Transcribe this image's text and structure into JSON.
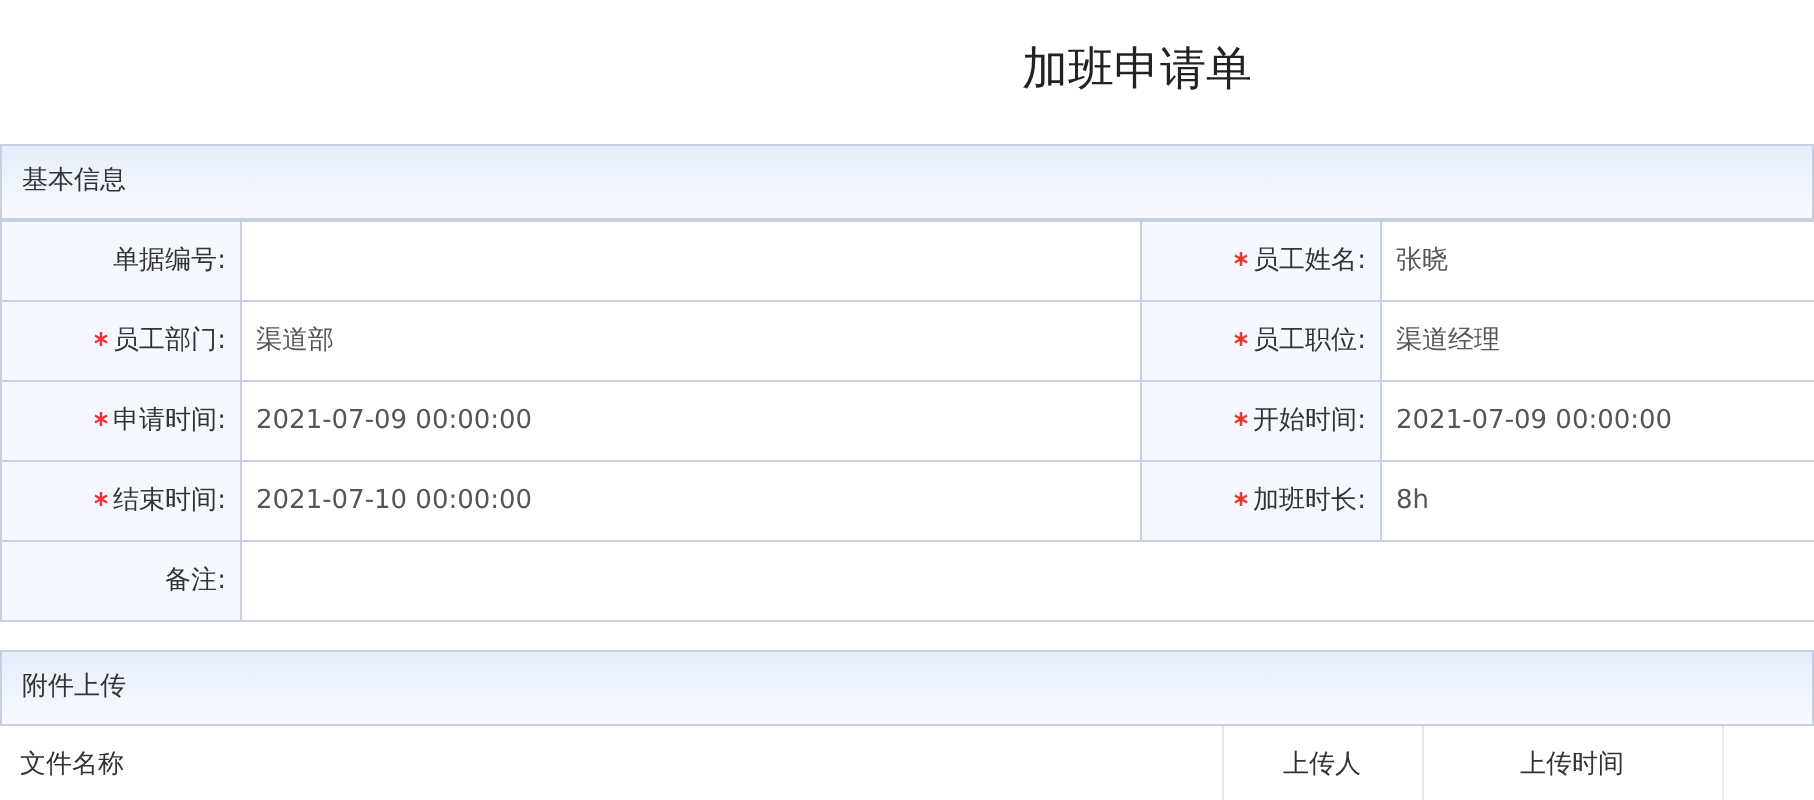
{
  "title": "加班申请单",
  "basic_info": {
    "heading": "基本信息",
    "rows": [
      [
        {
          "label": "单据编号:",
          "required": false
        },
        {
          "label": "员工姓名:",
          "required": true,
          "value": "张晓"
        }
      ],
      [
        {
          "label": "员工部门:",
          "required": true,
          "value": "渠道部"
        },
        {
          "label": "员工职位:",
          "required": true,
          "value": "渠道经理"
        }
      ],
      [
        {
          "label": "申请时间:",
          "required": true,
          "value": "2021-07-09 00:00:00"
        },
        {
          "label": "开始时间:",
          "required": true,
          "value": "2021-07-09 00:00:00"
        }
      ],
      [
        {
          "label": "结束时间:",
          "required": true,
          "value": "2021-07-10 00:00:00"
        },
        {
          "label": "加班时长:",
          "required": true,
          "value": "8h"
        }
      ],
      [
        {
          "label": "备注:",
          "required": false
        }
      ]
    ]
  },
  "attachments": {
    "heading": "附件上传",
    "table": {
      "columns": [
        "文件名称",
        "上传人",
        "上传时间"
      ]
    }
  }
}
